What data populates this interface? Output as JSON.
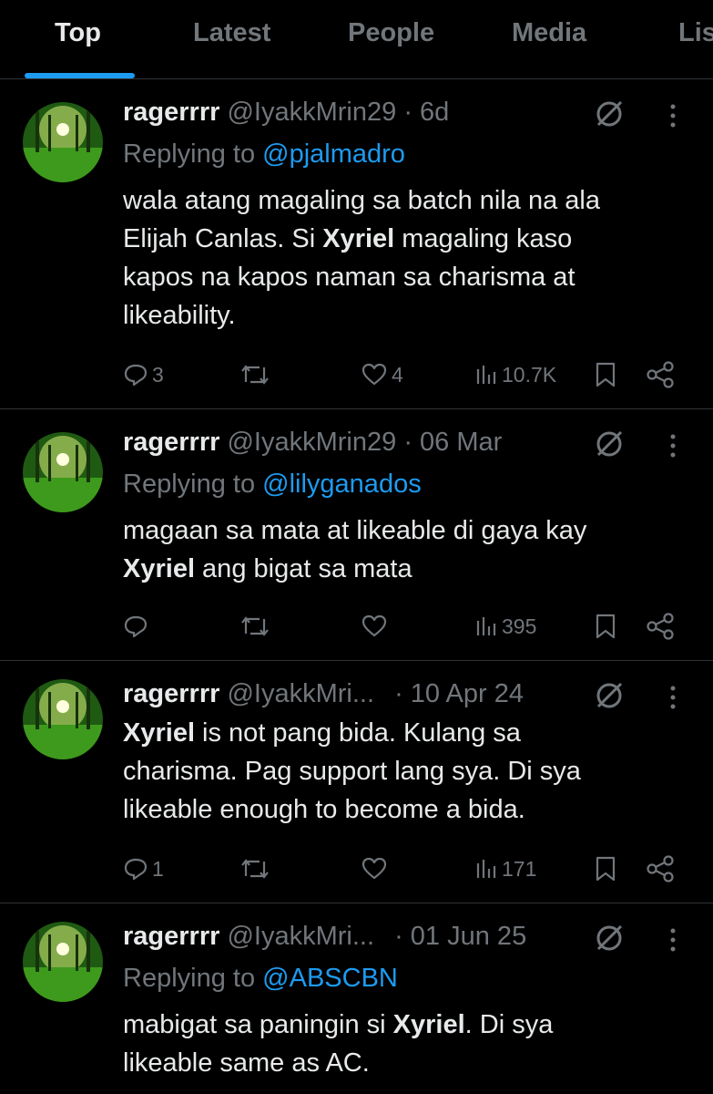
{
  "tabs": [
    {
      "label": "Top",
      "active": true
    },
    {
      "label": "Latest"
    },
    {
      "label": "People"
    },
    {
      "label": "Media"
    },
    {
      "label": "Lis"
    }
  ],
  "tweets": [
    {
      "display_name": "ragerrrr",
      "handle": "@IyakkMrin29",
      "time": "· 6d",
      "replying_prefix": "Replying to",
      "replying_to": "@pjalmadro",
      "body": [
        "wala atang magaling sa batch nila na ala",
        "Elijah Canlas. Si ",
        "Xyriel",
        " magaling kaso",
        "kapos na kapos naman sa charisma at",
        "likeability."
      ],
      "replies": "3",
      "likes": "4",
      "views": "10.7K"
    },
    {
      "display_name": "ragerrrr",
      "handle": "@IyakkMrin29",
      "time": "· 06 Mar",
      "replying_prefix": "Replying to",
      "replying_to": "@lilyganados",
      "body": [
        "magaan sa mata at likeable di gaya kay",
        "Xyriel",
        " ang bigat sa mata"
      ],
      "replies": "",
      "likes": "",
      "views": "395"
    },
    {
      "display_name": "ragerrrr",
      "handle": "@IyakkMri...",
      "time": "· 10 Apr 24",
      "body": [
        "Xyriel",
        " is not pang bida. Kulang sa",
        "charisma. Pag support lang sya. Di sya",
        "likeable enough to become a bida."
      ],
      "replies": "1",
      "likes": "",
      "views": "171"
    },
    {
      "display_name": "ragerrrr",
      "handle": "@IyakkMri...",
      "time": "· 01 Jun 25",
      "replying_prefix": "Replying to",
      "replying_to": "@ABSCBN",
      "body": [
        "mabigat sa paningin si ",
        "Xyriel",
        ". Di sya",
        "likeable same as AC."
      ]
    }
  ],
  "colors": {
    "accent": "#1d9bf0",
    "muted": "#71767b",
    "text": "#e7e9ea",
    "divider": "#2f3336"
  }
}
